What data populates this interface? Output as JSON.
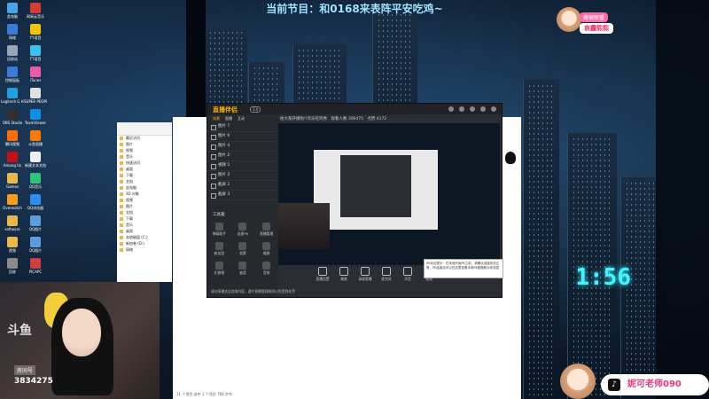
{
  "banner": {
    "text": "当前节目：和0168来表阵平安吃鸡~"
  },
  "badge": {
    "line1": "魔梗联盟",
    "line2": "哀霾熙熙"
  },
  "desktop_icons": [
    {
      "label": "此电脑",
      "color": "#4aa3e8"
    },
    {
      "label": "网易云音乐",
      "color": "#d43c33"
    },
    {
      "label": "网络",
      "color": "#3b7bd8"
    },
    {
      "label": "YY语音",
      "color": "#f5c400"
    },
    {
      "label": "回收站",
      "color": "#9aa5b1"
    },
    {
      "label": "TT语音",
      "color": "#3ac2f0"
    },
    {
      "label": "控制面板",
      "color": "#3b7bd8"
    },
    {
      "label": "iTunes",
      "color": "#e85da3"
    },
    {
      "label": "Logitech G HUB",
      "color": "#1fa0e0"
    },
    {
      "label": "SUPER PEOPLE",
      "color": "#e0e0e0"
    },
    {
      "label": "OBS Studio",
      "color": "#302e31"
    },
    {
      "label": "TeamViewer",
      "color": "#0e8ee9"
    },
    {
      "label": "腾讯视频",
      "color": "#ff6c00"
    },
    {
      "label": "斗鱼直播",
      "color": "#ff7b00"
    },
    {
      "label": "Among Us",
      "color": "#c51111"
    },
    {
      "label": "新建文本文档",
      "color": "#f0f0f0"
    },
    {
      "label": "Games",
      "color": "#e8b84a"
    },
    {
      "label": "QQ音乐",
      "color": "#31c27c"
    },
    {
      "label": "Overwatch",
      "color": "#f99e1a"
    },
    {
      "label": "QQ浏览器",
      "color": "#2b8ef0"
    },
    {
      "label": "software",
      "color": "#e8b84a"
    },
    {
      "label": "QQ图片",
      "color": "#5aa0e0"
    },
    {
      "label": "视频",
      "color": "#e8b84a"
    },
    {
      "label": "QQ图片",
      "color": "#5aa0e0"
    },
    {
      "label": "回收",
      "color": "#8a8a8a"
    },
    {
      "label": "PICAPC",
      "color": "#d04040"
    }
  ],
  "explorer": {
    "nav_rows": [
      "最近访问",
      "图片",
      "视频",
      "音乐",
      "快速访问",
      "桌面",
      "下载",
      "文档",
      "此电脑",
      "3D 对象",
      "视频",
      "图片",
      "文档",
      "下载",
      "音乐",
      "桌面",
      "本地磁盘 (C:)",
      "新加卷 (D:)",
      "网络"
    ],
    "status": "11 个项目    选中 1 个项目  760 字节"
  },
  "app": {
    "logo": "直播伴侣",
    "version": "3.0",
    "tabs": [
      {
        "label": "场景",
        "active": true
      },
      {
        "label": "直播",
        "active": false
      },
      {
        "label": "互动",
        "active": false
      }
    ],
    "scenes": [
      "图片 7",
      "图片 6",
      "图片 4",
      "图片 2",
      "视频 5",
      "图片 2",
      "截屏 2",
      "截屏 3"
    ],
    "tools_title": "工具箱",
    "tools": [
      "弹幕助手",
      "连麦PK",
      "直播管理",
      "粉丝团",
      "投票",
      "福袋",
      "礼物墙",
      "抽奖",
      "音效"
    ],
    "preview_title": "给大家开播啦!!欢乐吃鸡秀",
    "preview_stats": [
      "观看人数 306475",
      "点赞 4172"
    ],
    "bottom_buttons": [
      "直播设置",
      "美颜",
      "录屏直播",
      "麦克风",
      "声音",
      "视频"
    ],
    "notice": "请勿直播违法违规内容，遵守直播管理规则以免受到处罚"
  },
  "tooltip": {
    "text": "PK玩法提示：在本地开始PK之前，请确认连接状态正常，PK结束后可以在这里查看本场PK数据和对手信息"
  },
  "webcam": {
    "platform": "斗鱼",
    "room_label": "房间号",
    "room_number": "3834275"
  },
  "tiktok": {
    "logo": "♪",
    "handle": "妮可老师090"
  },
  "neon_sign": "1:56"
}
